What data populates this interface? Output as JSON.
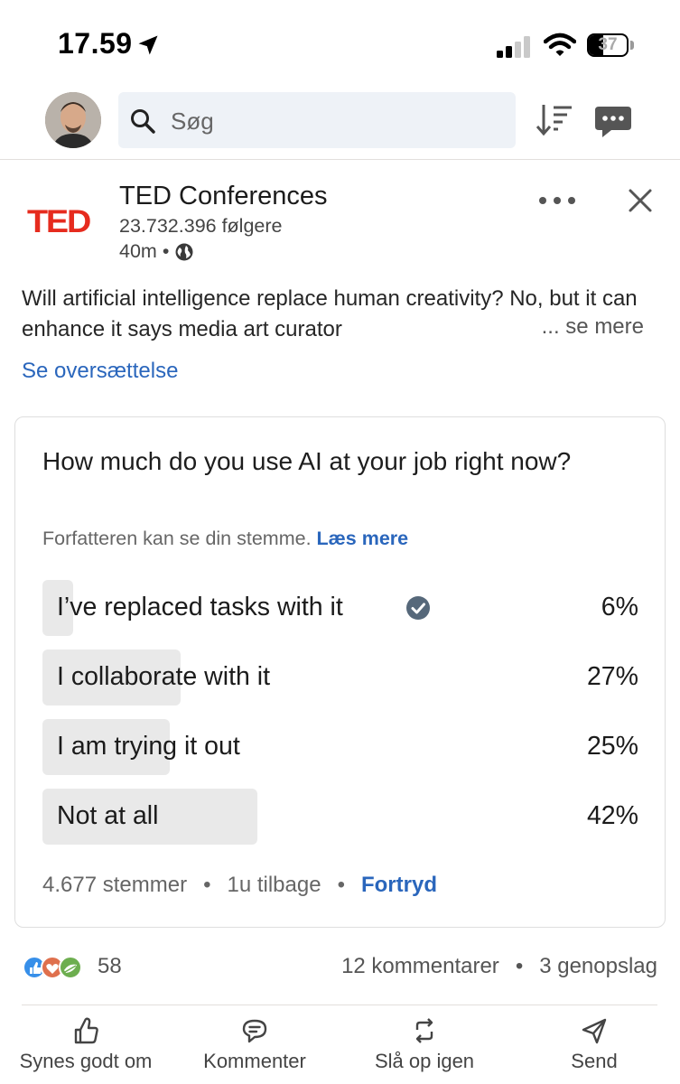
{
  "status_bar": {
    "time": "17.59",
    "battery_level": "37",
    "battery_fraction": 0.37
  },
  "header": {
    "search_placeholder": "Søg"
  },
  "post": {
    "author_name": "TED Conferences",
    "followers": "23.732.396 følgere",
    "age": "40m",
    "separator": "•",
    "logo_text": "TED",
    "text": "Will artificial intelligence replace human creativity? No, but it can enhance it says media art curator",
    "see_more": "... se mere",
    "translate": "Se oversættelse"
  },
  "poll": {
    "question": "How much do you use AI at your job right now?",
    "notice": "Forfatteren kan se din stemme.",
    "learn_more": "Læs mere",
    "options": [
      {
        "label": "I’ve replaced tasks with it",
        "percent": "6%",
        "value": 6,
        "selected": true
      },
      {
        "label": "I collaborate with it",
        "percent": "27%",
        "value": 27,
        "selected": false
      },
      {
        "label": "I am trying it out",
        "percent": "25%",
        "value": 25,
        "selected": false
      },
      {
        "label": "Not at all",
        "percent": "42%",
        "value": 42,
        "selected": false
      }
    ],
    "votes": "4.677 stemmer",
    "time_ago": "1u tilbage",
    "dot": "•",
    "undo": "Fortryd"
  },
  "social": {
    "reaction_count": "58",
    "comments": "12 kommentarer",
    "dot": "•",
    "reposts": "3 genopslag"
  },
  "actions": {
    "like": "Synes godt om",
    "comment": "Kommenter",
    "repost": "Slå op igen",
    "send": "Send"
  },
  "colors": {
    "link_blue": "#2a66bc",
    "ted_red": "#e62b1e",
    "poll_bar": "#e9e9e9",
    "search_bg": "#eef2f7"
  }
}
